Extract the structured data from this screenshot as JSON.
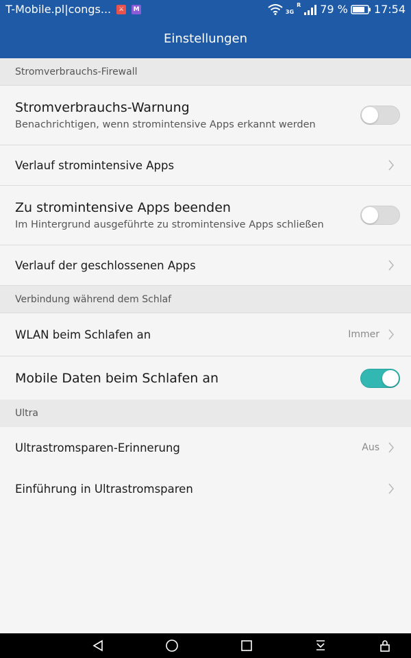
{
  "statusbar": {
    "carrier": "T-Mobile.pl|congs...",
    "notif1": "⚔",
    "notif2": "M",
    "network": "3G",
    "roaming": "R",
    "battery": "79 %",
    "time": "17:54"
  },
  "appbar": {
    "title": "Einstellungen"
  },
  "sections": {
    "firewall": "Stromverbrauchs-Firewall",
    "sleep": "Verbindung während dem Schlaf",
    "ultra": "Ultra"
  },
  "rows": {
    "warning": {
      "title": "Stromverbrauchs-Warnung",
      "subtitle": "Benachrichtigen, wenn stromintensive Apps erkannt werden",
      "enabled": false
    },
    "history_intensive": {
      "title": "Verlauf stromintensive Apps"
    },
    "close_intensive": {
      "title": "Zu stromintensive Apps beenden",
      "subtitle": "Im Hintergrund ausgeführte zu stromintensive Apps schließen",
      "enabled": false
    },
    "history_closed": {
      "title": "Verlauf der geschlossenen Apps"
    },
    "wlan_sleep": {
      "title": "WLAN beim Schlafen an",
      "value": "Immer"
    },
    "mobile_data_sleep": {
      "title": "Mobile Daten beim Schlafen an",
      "enabled": true
    },
    "ultra_reminder": {
      "title": "Ultrastromsparen-Erinnerung",
      "value": "Aus"
    },
    "ultra_intro": {
      "title": "Einführung in Ultrastromsparen"
    }
  },
  "colors": {
    "appbar": "#1e5aa6",
    "toggle_on": "#32b7b3",
    "section_bg": "#e9e9e9"
  },
  "icons": {
    "wifi": "wifi-icon",
    "signal": "signal-icon",
    "battery": "battery-icon",
    "back": "back-icon",
    "home": "home-icon",
    "recents": "recents-icon",
    "notifications": "notification-pull-icon",
    "lock": "lock-icon"
  }
}
